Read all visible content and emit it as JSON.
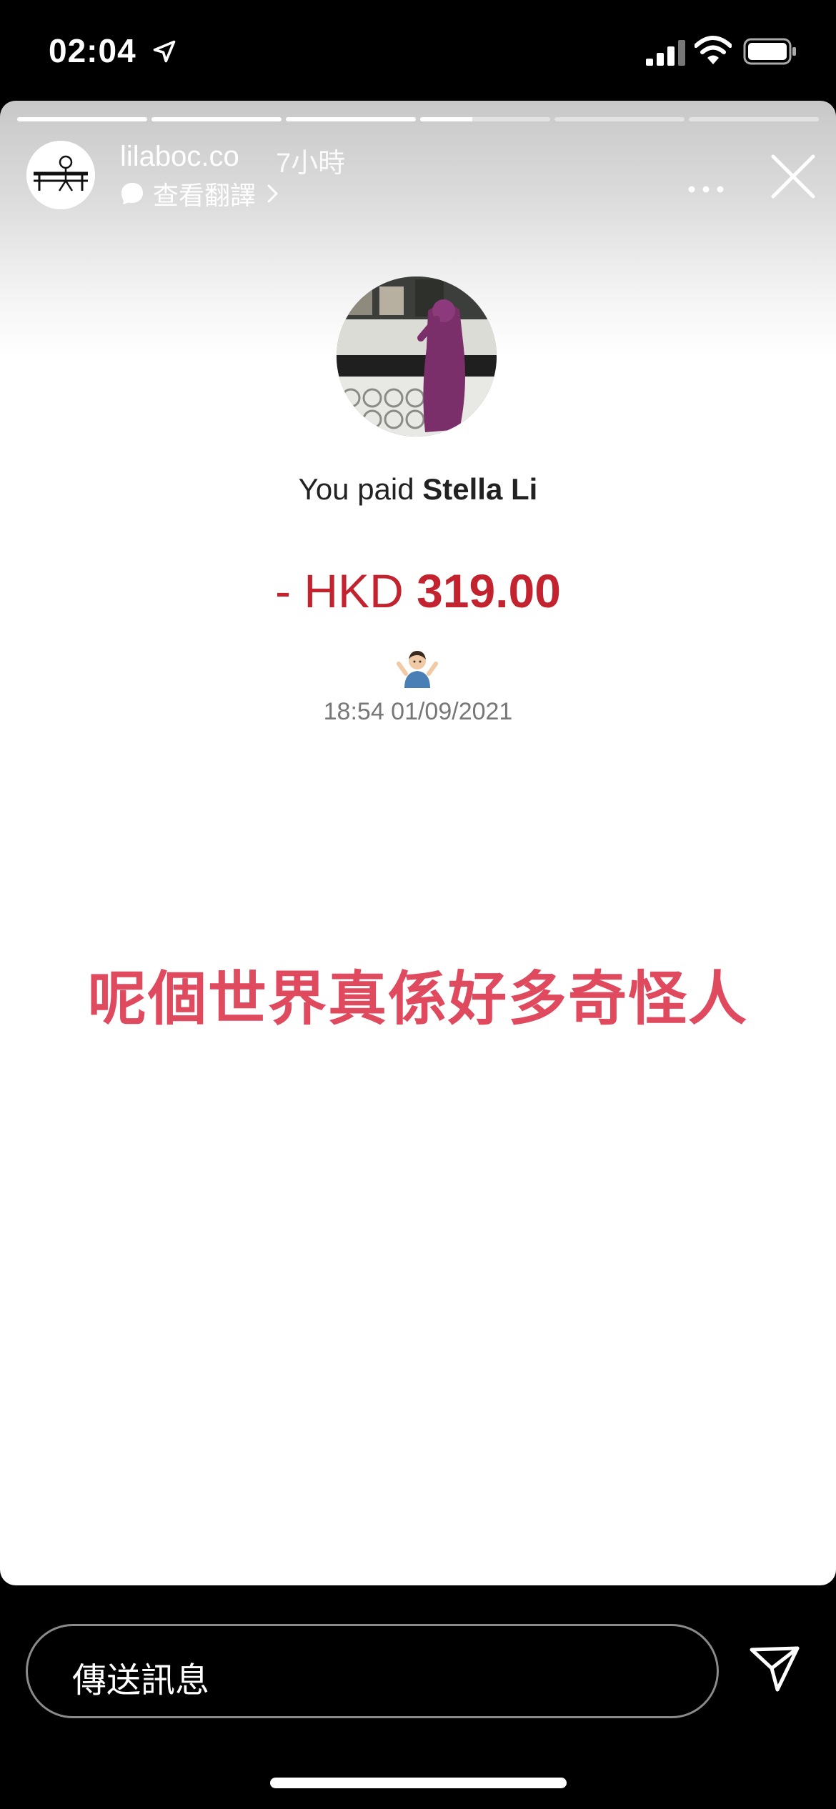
{
  "status_bar": {
    "time": "02:04",
    "icons": [
      "location-arrow-icon",
      "signal-icon",
      "wifi-icon",
      "battery-icon"
    ]
  },
  "story": {
    "progress": [
      1,
      1,
      1,
      0.4,
      0,
      0
    ],
    "username": "lilaboc.co",
    "time_ago": "7小時",
    "translate_label": "查看翻譯",
    "more_icon": "more-horizontal-icon",
    "close_icon": "close-icon"
  },
  "payment": {
    "paid_prefix": "You paid ",
    "payee_name": "Stella Li",
    "amount_prefix": "- HKD ",
    "amount_value": "319.00",
    "emoji": "person-shrugging-emoji",
    "datetime": "18:54 01/09/2021",
    "amount_color": "#c2232e"
  },
  "caption": {
    "text": "呢個世界真係好多奇怪人",
    "color": "#df4a5f"
  },
  "reply_bar": {
    "placeholder": "傳送訊息",
    "send_icon": "send-paper-plane-icon"
  }
}
